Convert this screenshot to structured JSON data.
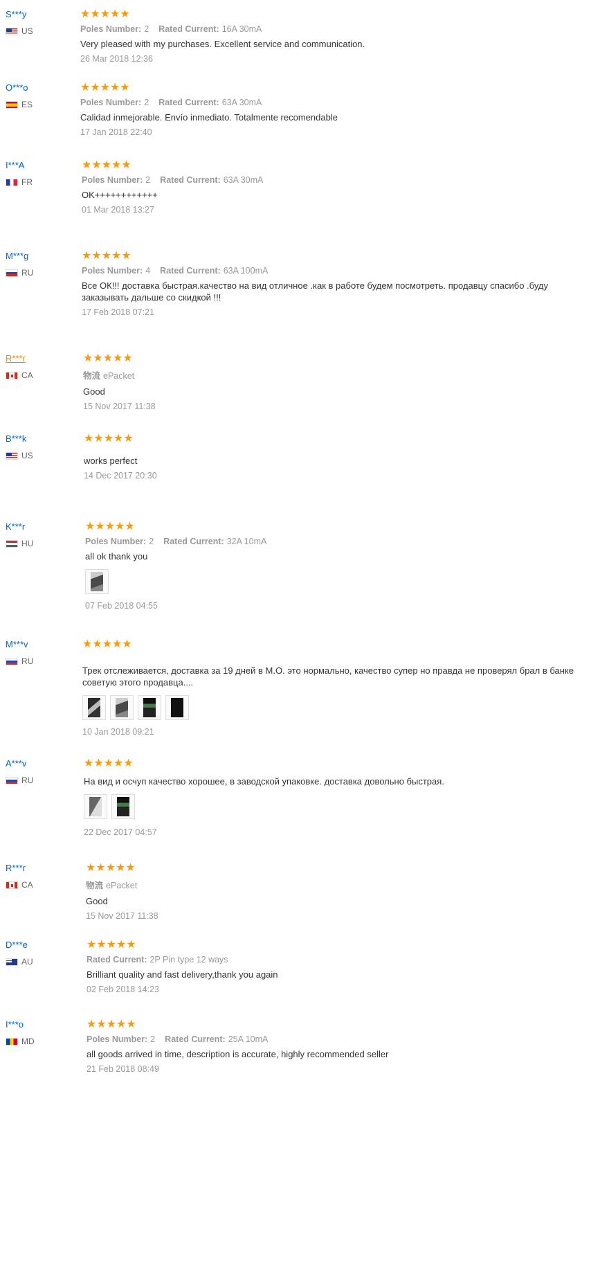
{
  "stars_glyph": "★★★★★",
  "reviews": [
    {
      "name": "S***y",
      "country": "US",
      "attr1_label": "Poles Number:",
      "attr1_value": "2",
      "attr2_label": "Rated Current:",
      "attr2_value": "16A 30mA",
      "text": "Very pleased with my purchases. Excellent service and communication.",
      "date": "26 Mar 2018 12:36"
    },
    {
      "name": "O***o",
      "country": "ES",
      "attr1_label": "Poles Number:",
      "attr1_value": "2",
      "attr2_label": "Rated Current:",
      "attr2_value": "63A 30mA",
      "text": "Calidad inmejorable. Envío inmediato. Totalmente recomendable",
      "date": "17 Jan 2018 22:40"
    },
    {
      "name": "I***A",
      "country": "FR",
      "attr1_label": "Poles Number:",
      "attr1_value": "2",
      "attr2_label": "Rated Current:",
      "attr2_value": "63A 30mA",
      "text": "OK++++++++++++",
      "date": "01 Mar 2018 13:27"
    },
    {
      "name": "M***g",
      "country": "RU",
      "attr1_label": "Poles Number:",
      "attr1_value": "4",
      "attr2_label": "Rated Current:",
      "attr2_value": "63A 100mA",
      "text": "Все ОК!!! доставка быстрая.качество на вид отличное .как в работе будем посмотреть. продавцу спасибо .буду заказывать дальше со скидкой !!!",
      "date": "17 Feb 2018 07:21"
    },
    {
      "name": "R***r",
      "country": "CA",
      "attr1_label": "物流",
      "attr1_value": "ePacket",
      "text": "Good",
      "date": "15 Nov 2017 11:38"
    },
    {
      "name": "B***k",
      "country": "US",
      "text": "works perfect",
      "date": "14 Dec 2017 20:30"
    },
    {
      "name": "K***r",
      "country": "HU",
      "attr1_label": "Poles Number:",
      "attr1_value": "2",
      "attr2_label": "Rated Current:",
      "attr2_value": "32A 10mA",
      "text": "all ok thank you",
      "date": "07 Feb 2018 04:55"
    },
    {
      "name": "M***v",
      "country": "RU",
      "text": "Трек отслеживается, доставка за 19 дней в М.О. это нормально, качество супер но правда не проверял брал в банке",
      "text2": "советую этого продавца....",
      "date": "10 Jan 2018 09:21"
    },
    {
      "name": "A***v",
      "country": "RU",
      "text": "На вид и осчуп качество хорошее, в заводской упаковке. доставка довольно быстрая.",
      "date": "22 Dec 2017 04:57"
    },
    {
      "name": "R***r",
      "country": "CA",
      "attr1_label": "物流",
      "attr1_value": "ePacket",
      "text": "Good",
      "date": "15 Nov 2017 11:38"
    },
    {
      "name": "D***e",
      "country": "AU",
      "attr1_label": "Rated Current:",
      "attr1_value": "2P Pin type 12 ways",
      "text": "Brilliant quality and fast delivery,thank you again",
      "date": "02 Feb 2018 14:23"
    },
    {
      "name": "I***o",
      "country": "MD",
      "attr1_label": "Poles Number:",
      "attr1_value": "2",
      "attr2_label": "Rated Current:",
      "attr2_value": "25A 10mA",
      "text": "all goods arrived in time, description is accurate, highly recommended seller",
      "date": "21 Feb 2018 08:49"
    }
  ]
}
